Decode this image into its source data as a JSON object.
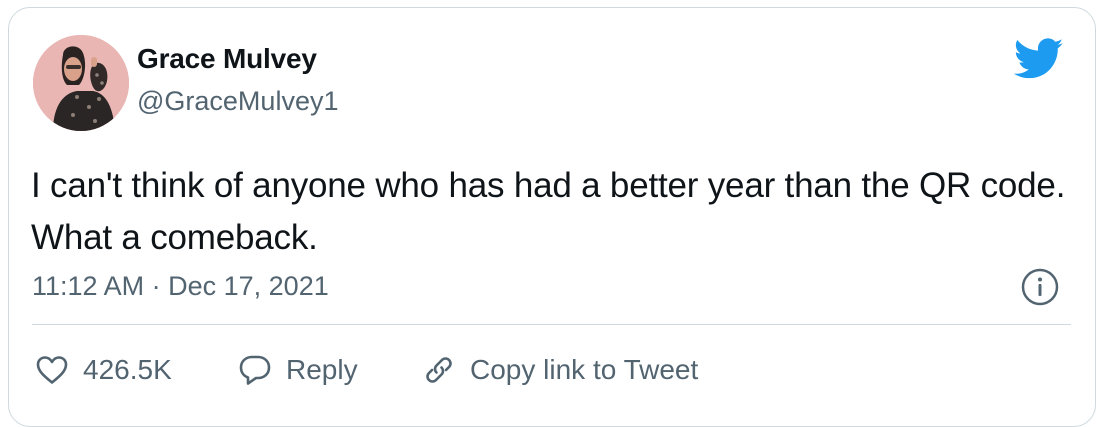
{
  "author": {
    "name": "Grace Mulvey",
    "handle": "@GraceMulvey1",
    "avatar_icon": "profile-photo"
  },
  "tweet": {
    "text": "I can't think of anyone who has had a better year than the QR code. What a comeback.",
    "time": "11:12 AM",
    "separator": "·",
    "date": "Dec 17, 2021"
  },
  "actions": {
    "like_count": "426.5K",
    "reply_label": "Reply",
    "copy_link_label": "Copy link to Tweet"
  },
  "icons": {
    "brand": "twitter-bird-icon",
    "info": "info-icon",
    "like": "heart-icon",
    "reply": "reply-bubble-icon",
    "copy": "link-icon"
  },
  "colors": {
    "brand_blue": "#1d9bf0",
    "text_primary": "#0f1419",
    "text_secondary": "#536471",
    "border": "#cfd9de"
  }
}
